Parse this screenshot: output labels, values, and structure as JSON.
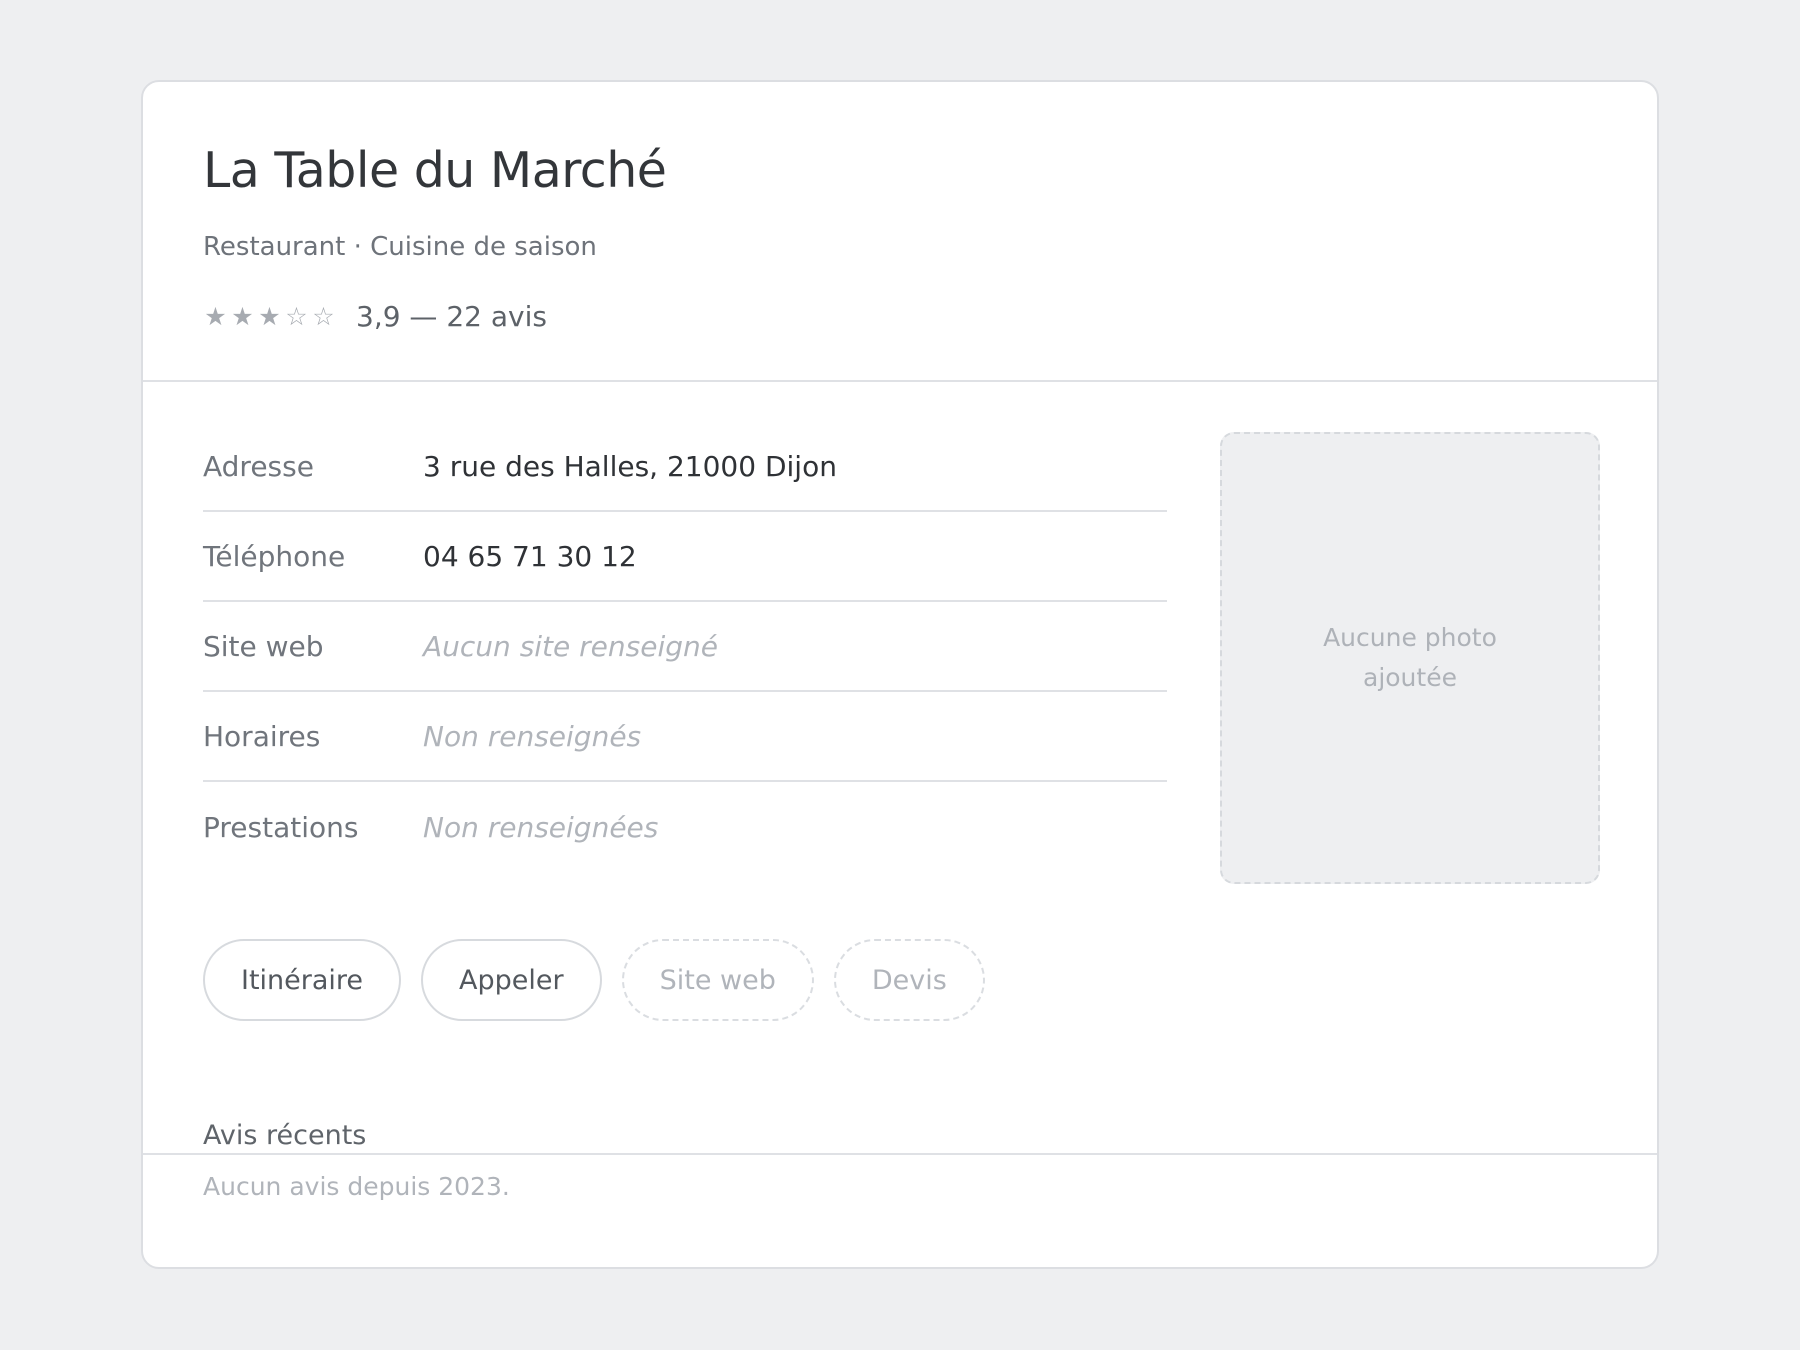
{
  "business": {
    "name": "La Table du Marché",
    "category": "Restaurant · Cuisine de saison",
    "rating": {
      "value": 3.9,
      "stars": [
        "★",
        "★",
        "★",
        "☆",
        "☆"
      ],
      "summary": "3,9 — 22 avis"
    }
  },
  "info": {
    "rows": [
      {
        "label": "Adresse",
        "value": "3 rue des Halles, 21000 Dijon"
      },
      {
        "label": "Téléphone",
        "value": "04 65 71 30 12"
      },
      {
        "label": "Site web",
        "value": "Aucun site renseigné"
      },
      {
        "label": "Horaires",
        "value": "Non renseignés"
      },
      {
        "label": "Prestations",
        "value": "Non renseignées"
      }
    ]
  },
  "photo": {
    "placeholder": "Aucune photo ajoutée"
  },
  "actions": {
    "directions": "Itinéraire",
    "call": "Appeler",
    "website": "Site web",
    "quote": "Devis"
  },
  "reviews": {
    "title": "Avis récents",
    "empty": "Aucun avis depuis 2023."
  },
  "colors": {
    "background": "#eeeff1",
    "card": "#ffffff",
    "title": "#33363a",
    "muted": "#b0b4ba"
  }
}
